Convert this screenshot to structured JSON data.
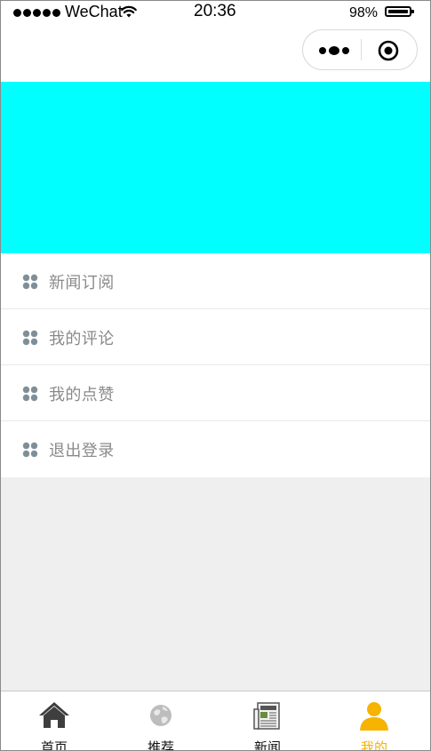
{
  "status_bar": {
    "carrier": "WeChat",
    "time": "20:36",
    "battery": "98%"
  },
  "capsule": {
    "more_icon": "more-dots-icon",
    "close_icon": "target-circle-icon"
  },
  "banner": {
    "color": "#00ffff"
  },
  "menu": {
    "items": [
      {
        "label": "新闻订阅",
        "icon": "dots-grid-icon"
      },
      {
        "label": "我的评论",
        "icon": "dots-grid-icon"
      },
      {
        "label": "我的点赞",
        "icon": "dots-grid-icon"
      },
      {
        "label": "退出登录",
        "icon": "dots-grid-icon"
      }
    ]
  },
  "tab_bar": {
    "tabs": [
      {
        "label": "首页",
        "icon": "home-icon",
        "active": false
      },
      {
        "label": "推荐",
        "icon": "globe-icon",
        "active": false
      },
      {
        "label": "新闻",
        "icon": "newspaper-icon",
        "active": false
      },
      {
        "label": "我的",
        "icon": "user-icon",
        "active": true
      }
    ],
    "active_color": "#f6b300"
  }
}
